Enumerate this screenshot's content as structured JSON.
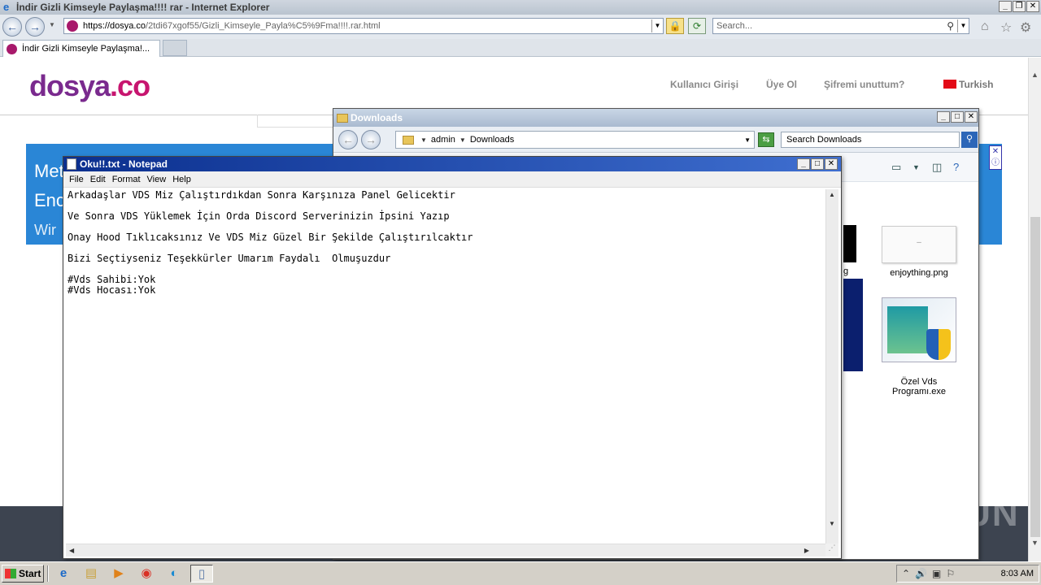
{
  "browser": {
    "window_title": "İndir Gizli Kimseyle Paylaşma!!!! rar - Internet Explorer",
    "url_host": "https://dosya.co",
    "url_path": "/2tdi67xgof55/Gizli_Kimseyle_Payla%C5%9Fma!!!!.rar.html",
    "search_placeholder": "Search...",
    "tab_title": "İndir Gizli Kimseyle Paylaşma!..."
  },
  "site": {
    "logo_main": "dosya",
    "logo_suffix": ".co",
    "nav": [
      "Kullanıcı Girişi",
      "Üye Ol",
      "Şifremi unuttum?",
      "Turkish"
    ],
    "banner_lines": [
      "Met",
      "Enc",
      "Wir"
    ]
  },
  "explorer": {
    "title": "Downloads",
    "breadcrumb": [
      "admin",
      "Downloads"
    ],
    "search_placeholder": "Search Downloads",
    "partial_label": "g",
    "files": [
      {
        "name": "enjoything.png"
      },
      {
        "name": "Özel Vds\nProgramı.exe"
      }
    ]
  },
  "notepad": {
    "title": "Oku!!.txt - Notepad",
    "menu": [
      "File",
      "Edit",
      "Format",
      "View",
      "Help"
    ],
    "content": "Arkadaşlar VDS Miz Çalıştırdıkdan Sonra Karşınıza Panel Gelicektir\n\nVe Sonra VDS Yüklemek İçin Orda Discord Serverinizin İpsini Yazıp\n\nOnay Hood Tıklıcaksınız Ve VDS Miz Güzel Bir Şekilde Çalıştırılcaktır\n\nBizi Seçtiyseniz Teşekkürler Umarım Faydalı  Olmuşuzdur\n\n#Vds Sahibi:Yok\n#Vds Hocası:Yok"
  },
  "taskbar": {
    "start_label": "Start",
    "clock": "8:03 AM"
  },
  "watermark": "ANY RUN"
}
